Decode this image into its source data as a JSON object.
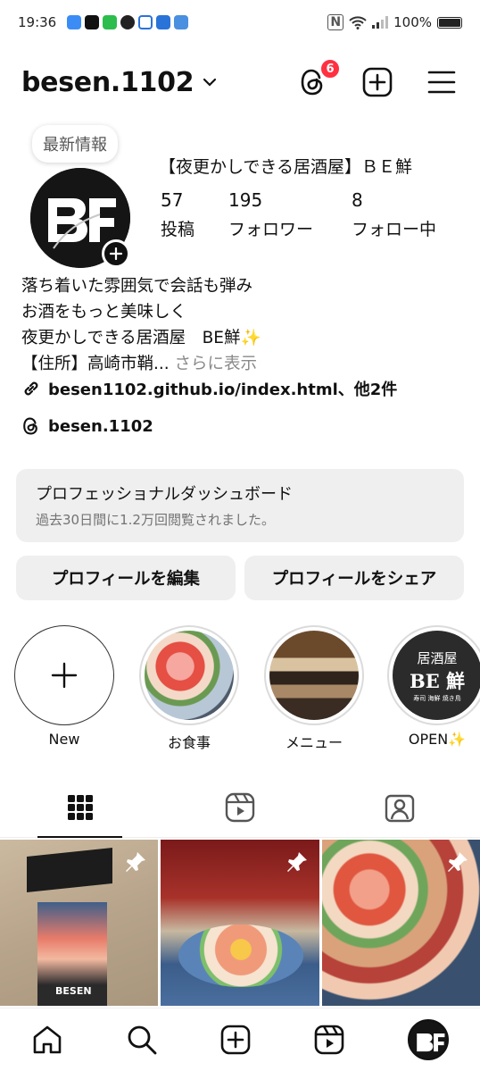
{
  "status_bar": {
    "time": "19:36",
    "battery": "100%"
  },
  "header": {
    "username": "besen.1102",
    "notification_count": "6"
  },
  "profile": {
    "note": "最新情報",
    "display_name": "【夜更かしできる居酒屋】ＢＥ鮮",
    "stats": [
      {
        "value": "57",
        "label": "投稿"
      },
      {
        "value": "195",
        "label": "フォロワー"
      },
      {
        "value": "8",
        "label": "フォロー中"
      }
    ],
    "bio_lines": [
      "落ち着いた雰囲気で会話も弾み",
      "お酒をもっと美味しく",
      "夜更かしできる居酒屋　BE鮮✨",
      "【住所】高崎市鞘..."
    ],
    "bio_more": "さらに表示",
    "link": "besen1102.github.io/index.html、他2件",
    "threads_handle": "besen.1102"
  },
  "dashboard": {
    "title": "プロフェッショナルダッシュボード",
    "subtitle": "過去30日間に1.2万回閲覧されました。"
  },
  "buttons": {
    "edit": "プロフィールを編集",
    "share": "プロフィールをシェア"
  },
  "highlights": [
    {
      "label": "New"
    },
    {
      "label": "お食事"
    },
    {
      "label": "メニュー"
    },
    {
      "label": "OPEN✨"
    }
  ],
  "highlight_sign": {
    "line1": "居酒屋",
    "line2": "BE 鮮",
    "line3": "寿司 海鮮 焼き鳥"
  },
  "post_logo": "BESEN",
  "colors": {
    "badge": "#ff3040",
    "button_bg": "#efefef",
    "muted": "#737373"
  }
}
